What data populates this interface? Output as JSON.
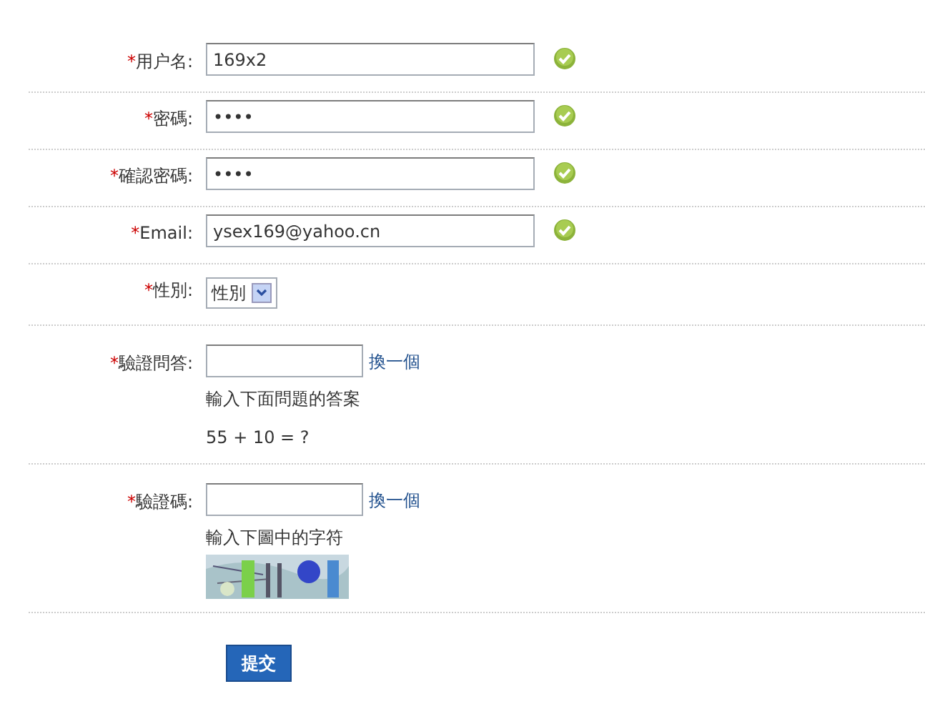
{
  "fields": [
    {
      "kind": "text",
      "mark": "*",
      "label": "用户名:",
      "value": "169x2",
      "valid": true
    },
    {
      "kind": "text",
      "mark": "*",
      "label": "密碼:",
      "value": "••••",
      "valid": true
    },
    {
      "kind": "text",
      "mark": "*",
      "label": "確認密碼:",
      "value": "••••",
      "valid": true
    },
    {
      "kind": "text",
      "mark": "*",
      "label": "Email:",
      "value": "ysex169@yahoo.cn",
      "valid": true
    },
    {
      "kind": "select",
      "mark": "*",
      "label": "性別:",
      "value": "性別"
    },
    {
      "kind": "question",
      "mark": "*",
      "label": "驗證問答:",
      "refresh": "換一個",
      "hint": "輸入下面問題的答案",
      "question": "55 + 10 = ?"
    },
    {
      "kind": "captcha",
      "mark": "*",
      "label": "驗證碼:",
      "refresh": "換一個",
      "hint": "輸入下圖中的字符"
    }
  ],
  "submit": "提交"
}
